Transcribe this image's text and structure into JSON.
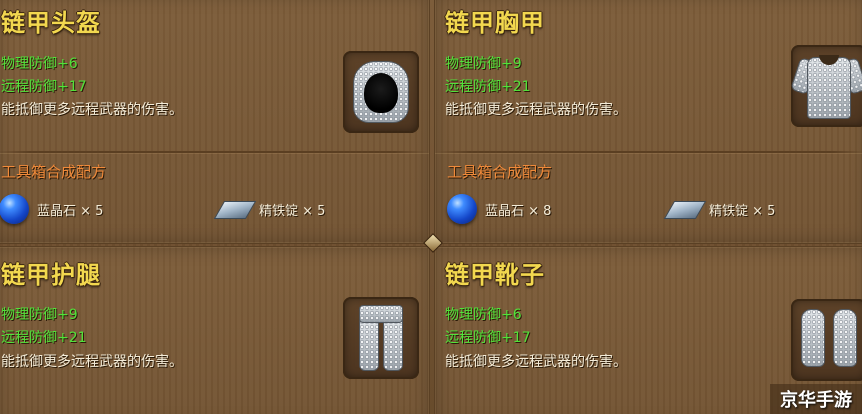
{
  "cards": [
    {
      "title": "链甲头盔",
      "stats": [
        "物理防御+6",
        "远程防御+17"
      ],
      "description": "能抵御更多远程武器的伤害。",
      "recipe_title": "工具箱合成配方",
      "ingredients": [
        {
          "label": "蓝晶石 × 5",
          "icon": "sapphire-icon"
        },
        {
          "label": "精铁锭 × 5",
          "icon": "iron-ingot-icon"
        }
      ],
      "item_icon": "chain-helmet-icon"
    },
    {
      "title": "链甲胸甲",
      "stats": [
        "物理防御+9",
        "远程防御+21"
      ],
      "description": "能抵御更多远程武器的伤害。",
      "recipe_title": "工具箱合成配方",
      "ingredients": [
        {
          "label": "蓝晶石 × 8",
          "icon": "sapphire-icon"
        },
        {
          "label": "精铁锭 × 5",
          "icon": "iron-ingot-icon"
        }
      ],
      "item_icon": "chain-chestplate-icon"
    },
    {
      "title": "链甲护腿",
      "stats": [
        "物理防御+9",
        "远程防御+21"
      ],
      "description": "能抵御更多远程武器的伤害。",
      "item_icon": "chain-leggings-icon"
    },
    {
      "title": "链甲靴子",
      "stats": [
        "物理防御+6",
        "远程防御+17"
      ],
      "description": "能抵御更多远程武器的伤害。",
      "item_icon": "chain-boots-icon"
    }
  ],
  "watermark": "京华手游",
  "colors": {
    "title": "#f2d84f",
    "stat": "#52e23a",
    "recipe_title": "#f08a3a",
    "panel": "#7d5d3a"
  }
}
